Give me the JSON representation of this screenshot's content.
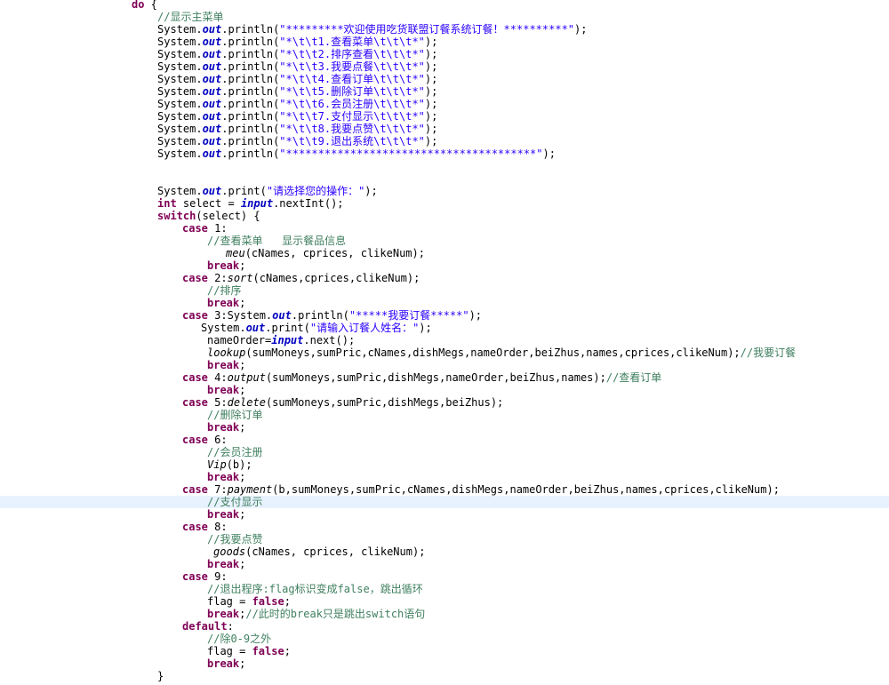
{
  "editor": {
    "current_line_index": 40,
    "lines": [
      {
        "indent": 148,
        "tokens": [
          {
            "t": "kw",
            "v": "do"
          },
          {
            "t": "p",
            "v": " {"
          }
        ]
      },
      {
        "indent": 177,
        "tokens": [
          {
            "t": "cmt",
            "v": "//显示主菜单"
          }
        ]
      },
      {
        "indent": 177,
        "tokens": [
          {
            "t": "p",
            "v": "System."
          },
          {
            "t": "fld",
            "v": "out"
          },
          {
            "t": "p",
            "v": ".println("
          },
          {
            "t": "str",
            "v": "\"*********欢迎使用吃货联盟订餐系统订餐！**********\""
          },
          {
            "t": "p",
            "v": ");"
          }
        ]
      },
      {
        "indent": 177,
        "tokens": [
          {
            "t": "p",
            "v": "System."
          },
          {
            "t": "fld",
            "v": "out"
          },
          {
            "t": "p",
            "v": ".println("
          },
          {
            "t": "str",
            "v": "\"*\\t\\t1.查看菜单\\t\\t\\t*\""
          },
          {
            "t": "p",
            "v": ");"
          }
        ]
      },
      {
        "indent": 177,
        "tokens": [
          {
            "t": "p",
            "v": "System."
          },
          {
            "t": "fld",
            "v": "out"
          },
          {
            "t": "p",
            "v": ".println("
          },
          {
            "t": "str",
            "v": "\"*\\t\\t2.排序查看\\t\\t\\t*\""
          },
          {
            "t": "p",
            "v": ");"
          }
        ]
      },
      {
        "indent": 177,
        "tokens": [
          {
            "t": "p",
            "v": "System."
          },
          {
            "t": "fld",
            "v": "out"
          },
          {
            "t": "p",
            "v": ".println("
          },
          {
            "t": "str",
            "v": "\"*\\t\\t3.我要点餐\\t\\t\\t*\""
          },
          {
            "t": "p",
            "v": ");"
          }
        ]
      },
      {
        "indent": 177,
        "tokens": [
          {
            "t": "p",
            "v": "System."
          },
          {
            "t": "fld",
            "v": "out"
          },
          {
            "t": "p",
            "v": ".println("
          },
          {
            "t": "str",
            "v": "\"*\\t\\t4.查看订单\\t\\t\\t*\""
          },
          {
            "t": "p",
            "v": ");"
          }
        ]
      },
      {
        "indent": 177,
        "tokens": [
          {
            "t": "p",
            "v": "System."
          },
          {
            "t": "fld",
            "v": "out"
          },
          {
            "t": "p",
            "v": ".println("
          },
          {
            "t": "str",
            "v": "\"*\\t\\t5.删除订单\\t\\t\\t*\""
          },
          {
            "t": "p",
            "v": ");"
          }
        ]
      },
      {
        "indent": 177,
        "tokens": [
          {
            "t": "p",
            "v": "System."
          },
          {
            "t": "fld",
            "v": "out"
          },
          {
            "t": "p",
            "v": ".println("
          },
          {
            "t": "str",
            "v": "\"*\\t\\t6.会员注册\\t\\t\\t*\""
          },
          {
            "t": "p",
            "v": ");"
          }
        ]
      },
      {
        "indent": 177,
        "tokens": [
          {
            "t": "p",
            "v": "System."
          },
          {
            "t": "fld",
            "v": "out"
          },
          {
            "t": "p",
            "v": ".println("
          },
          {
            "t": "str",
            "v": "\"*\\t\\t7.支付显示\\t\\t\\t*\""
          },
          {
            "t": "p",
            "v": ");"
          }
        ]
      },
      {
        "indent": 177,
        "tokens": [
          {
            "t": "p",
            "v": "System."
          },
          {
            "t": "fld",
            "v": "out"
          },
          {
            "t": "p",
            "v": ".println("
          },
          {
            "t": "str",
            "v": "\"*\\t\\t8.我要点赞\\t\\t\\t*\""
          },
          {
            "t": "p",
            "v": ");"
          }
        ]
      },
      {
        "indent": 177,
        "tokens": [
          {
            "t": "p",
            "v": "System."
          },
          {
            "t": "fld",
            "v": "out"
          },
          {
            "t": "p",
            "v": ".println("
          },
          {
            "t": "str",
            "v": "\"*\\t\\t9.退出系统\\t\\t\\t*\""
          },
          {
            "t": "p",
            "v": ");"
          }
        ]
      },
      {
        "indent": 177,
        "tokens": [
          {
            "t": "p",
            "v": "System."
          },
          {
            "t": "fld",
            "v": "out"
          },
          {
            "t": "p",
            "v": ".println("
          },
          {
            "t": "str",
            "v": "\"***************************************\""
          },
          {
            "t": "p",
            "v": ");"
          }
        ]
      },
      {
        "indent": 177,
        "tokens": []
      },
      {
        "indent": 177,
        "tokens": []
      },
      {
        "indent": 177,
        "tokens": [
          {
            "t": "p",
            "v": "System."
          },
          {
            "t": "fld",
            "v": "out"
          },
          {
            "t": "p",
            "v": ".print("
          },
          {
            "t": "str",
            "v": "\"请选择您的操作：\""
          },
          {
            "t": "p",
            "v": ");"
          }
        ]
      },
      {
        "indent": 177,
        "tokens": [
          {
            "t": "kw",
            "v": "int"
          },
          {
            "t": "p",
            "v": " select = "
          },
          {
            "t": "fld",
            "v": "input"
          },
          {
            "t": "p",
            "v": ".nextInt();"
          }
        ]
      },
      {
        "indent": 177,
        "tokens": [
          {
            "t": "kw",
            "v": "switch"
          },
          {
            "t": "p",
            "v": "(select) {"
          }
        ]
      },
      {
        "indent": 205,
        "tokens": [
          {
            "t": "kw",
            "v": "case"
          },
          {
            "t": "p",
            "v": " 1:"
          }
        ]
      },
      {
        "indent": 233,
        "tokens": [
          {
            "t": "cmt",
            "v": "//查看菜单   显示餐品信息"
          }
        ]
      },
      {
        "indent": 254,
        "tokens": [
          {
            "t": "mth",
            "v": "meu"
          },
          {
            "t": "p",
            "v": "(cNames, cprices, clikeNum);"
          }
        ]
      },
      {
        "indent": 233,
        "tokens": [
          {
            "t": "kw",
            "v": "break"
          },
          {
            "t": "p",
            "v": ";"
          }
        ]
      },
      {
        "indent": 205,
        "tokens": [
          {
            "t": "kw",
            "v": "case"
          },
          {
            "t": "p",
            "v": " 2:"
          },
          {
            "t": "mth",
            "v": "sort"
          },
          {
            "t": "p",
            "v": "(cNames,cprices,clikeNum);"
          }
        ]
      },
      {
        "indent": 233,
        "tokens": [
          {
            "t": "cmt",
            "v": "//排序"
          }
        ]
      },
      {
        "indent": 233,
        "tokens": [
          {
            "t": "kw",
            "v": "break"
          },
          {
            "t": "p",
            "v": ";"
          }
        ]
      },
      {
        "indent": 205,
        "tokens": [
          {
            "t": "kw",
            "v": "case"
          },
          {
            "t": "p",
            "v": " 3:System."
          },
          {
            "t": "fld",
            "v": "out"
          },
          {
            "t": "p",
            "v": ".println("
          },
          {
            "t": "str",
            "v": "\"*****我要订餐*****\""
          },
          {
            "t": "p",
            "v": ");"
          }
        ]
      },
      {
        "indent": 226,
        "tokens": [
          {
            "t": "p",
            "v": "System."
          },
          {
            "t": "fld",
            "v": "out"
          },
          {
            "t": "p",
            "v": ".print("
          },
          {
            "t": "str",
            "v": "\"请输入订餐人姓名：\""
          },
          {
            "t": "p",
            "v": ");"
          }
        ]
      },
      {
        "indent": 233,
        "tokens": [
          {
            "t": "p",
            "v": "nameOrder="
          },
          {
            "t": "fld",
            "v": "input"
          },
          {
            "t": "p",
            "v": ".next();"
          }
        ]
      },
      {
        "indent": 233,
        "tokens": [
          {
            "t": "mth",
            "v": "lookup"
          },
          {
            "t": "p",
            "v": "(sumMoneys,sumPric,cNames,dishMegs,nameOrder,beiZhus,names,cprices,clikeNum);"
          },
          {
            "t": "cmt",
            "v": "//我要订餐"
          }
        ]
      },
      {
        "indent": 233,
        "tokens": [
          {
            "t": "kw",
            "v": "break"
          },
          {
            "t": "p",
            "v": ";"
          }
        ]
      },
      {
        "indent": 205,
        "tokens": [
          {
            "t": "kw",
            "v": "case"
          },
          {
            "t": "p",
            "v": " 4:"
          },
          {
            "t": "mth",
            "v": "output"
          },
          {
            "t": "p",
            "v": "(sumMoneys,sumPric,dishMegs,nameOrder,beiZhus,names);"
          },
          {
            "t": "cmt",
            "v": "//查看订单"
          }
        ]
      },
      {
        "indent": 233,
        "tokens": [
          {
            "t": "kw",
            "v": "break"
          },
          {
            "t": "p",
            "v": ";"
          }
        ]
      },
      {
        "indent": 205,
        "tokens": [
          {
            "t": "kw",
            "v": "case"
          },
          {
            "t": "p",
            "v": " 5:"
          },
          {
            "t": "mth",
            "v": "delete"
          },
          {
            "t": "p",
            "v": "(sumMoneys,sumPric,dishMegs,beiZhus);"
          }
        ]
      },
      {
        "indent": 233,
        "tokens": [
          {
            "t": "cmt",
            "v": "//删除订单"
          }
        ]
      },
      {
        "indent": 233,
        "tokens": [
          {
            "t": "kw",
            "v": "break"
          },
          {
            "t": "p",
            "v": ";"
          }
        ]
      },
      {
        "indent": 205,
        "tokens": [
          {
            "t": "kw",
            "v": "case"
          },
          {
            "t": "p",
            "v": " 6:"
          }
        ]
      },
      {
        "indent": 233,
        "tokens": [
          {
            "t": "cmt",
            "v": "//会员注册"
          }
        ]
      },
      {
        "indent": 233,
        "tokens": [
          {
            "t": "mth",
            "v": "Vip"
          },
          {
            "t": "p",
            "v": "(b);"
          }
        ]
      },
      {
        "indent": 233,
        "tokens": [
          {
            "t": "kw",
            "v": "break"
          },
          {
            "t": "p",
            "v": ";"
          }
        ]
      },
      {
        "indent": 205,
        "tokens": [
          {
            "t": "kw",
            "v": "case"
          },
          {
            "t": "p",
            "v": " 7:"
          },
          {
            "t": "mth",
            "v": "payment"
          },
          {
            "t": "p",
            "v": "(b,sumMoneys,sumPric,cNames,dishMegs,nameOrder,beiZhus,names,cprices,clikeNum);"
          }
        ]
      },
      {
        "indent": 233,
        "tokens": [
          {
            "t": "cmt",
            "v": "//支付显示"
          }
        ]
      },
      {
        "indent": 233,
        "tokens": [
          {
            "t": "kw",
            "v": "break"
          },
          {
            "t": "p",
            "v": ";"
          }
        ]
      },
      {
        "indent": 205,
        "tokens": [
          {
            "t": "kw",
            "v": "case"
          },
          {
            "t": "p",
            "v": " 8:"
          }
        ]
      },
      {
        "indent": 233,
        "tokens": [
          {
            "t": "cmt",
            "v": "//我要点赞"
          }
        ]
      },
      {
        "indent": 240,
        "tokens": [
          {
            "t": "mth",
            "v": "goods"
          },
          {
            "t": "p",
            "v": "(cNames, cprices, clikeNum);"
          }
        ]
      },
      {
        "indent": 233,
        "tokens": [
          {
            "t": "kw",
            "v": "break"
          },
          {
            "t": "p",
            "v": ";"
          }
        ]
      },
      {
        "indent": 205,
        "tokens": [
          {
            "t": "kw",
            "v": "case"
          },
          {
            "t": "p",
            "v": " 9:"
          }
        ]
      },
      {
        "indent": 233,
        "tokens": [
          {
            "t": "cmt",
            "v": "//退出程序:flag标识变成false，跳出循环"
          }
        ]
      },
      {
        "indent": 233,
        "tokens": [
          {
            "t": "p",
            "v": "flag = "
          },
          {
            "t": "kw",
            "v": "false"
          },
          {
            "t": "p",
            "v": ";"
          }
        ]
      },
      {
        "indent": 233,
        "tokens": [
          {
            "t": "kw",
            "v": "break"
          },
          {
            "t": "p",
            "v": ";"
          },
          {
            "t": "cmt",
            "v": "//此时的break只是跳出switch语句"
          }
        ]
      },
      {
        "indent": 205,
        "tokens": [
          {
            "t": "kw",
            "v": "default"
          },
          {
            "t": "p",
            "v": ":"
          }
        ]
      },
      {
        "indent": 233,
        "tokens": [
          {
            "t": "cmt",
            "v": "//除0-9之外"
          }
        ]
      },
      {
        "indent": 233,
        "tokens": [
          {
            "t": "p",
            "v": "flag = "
          },
          {
            "t": "kw",
            "v": "false"
          },
          {
            "t": "p",
            "v": ";"
          }
        ]
      },
      {
        "indent": 233,
        "tokens": [
          {
            "t": "kw",
            "v": "break"
          },
          {
            "t": "p",
            "v": ";"
          }
        ]
      },
      {
        "indent": 177,
        "tokens": [
          {
            "t": "p",
            "v": "}"
          }
        ]
      }
    ]
  }
}
